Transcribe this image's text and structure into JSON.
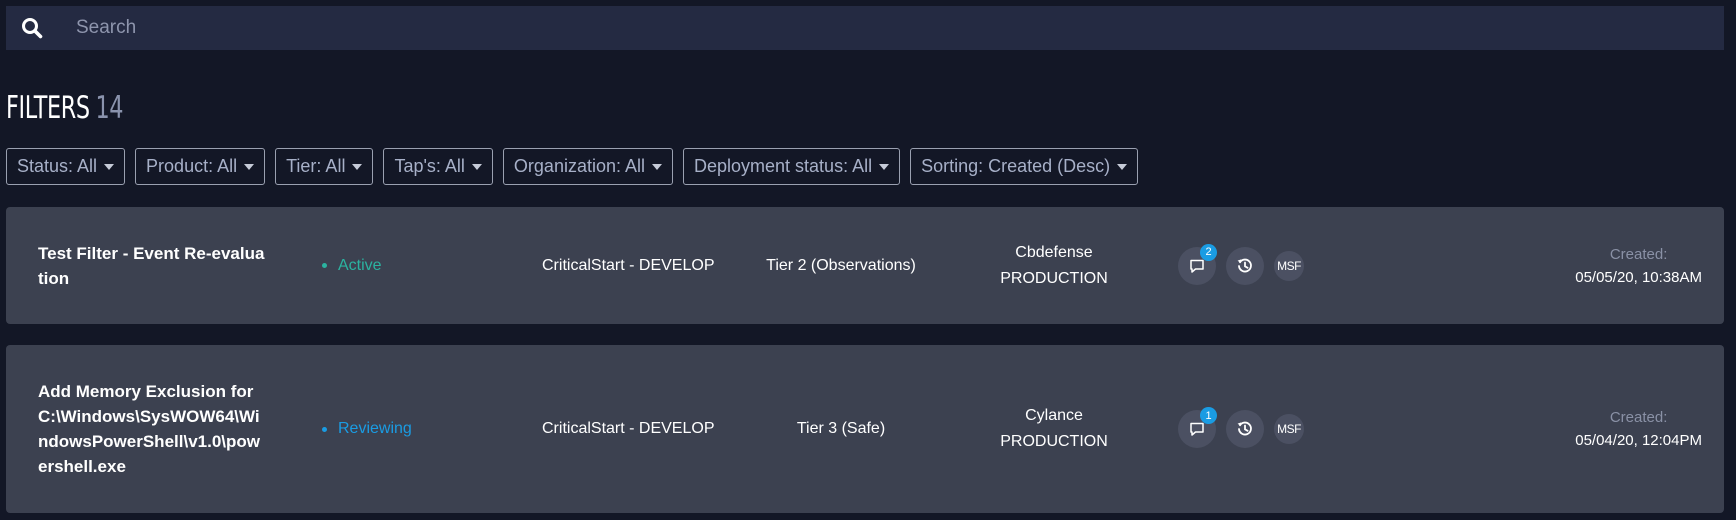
{
  "search": {
    "placeholder": "Search"
  },
  "header": {
    "title": "FILTERS",
    "count": "14"
  },
  "filterbar": [
    {
      "label": "Status: All"
    },
    {
      "label": "Product: All"
    },
    {
      "label": "Tier: All"
    },
    {
      "label": "Tap's: All"
    },
    {
      "label": "Organization: All"
    },
    {
      "label": "Deployment status: All"
    },
    {
      "label": "Sorting: Created (Desc)"
    }
  ],
  "colors": {
    "background": "#131726",
    "card": "#3c4150",
    "status_active": "#2bb3a0",
    "status_reviewing": "#1a9ce3",
    "badge": "#1a9ce3"
  },
  "filters": [
    {
      "name": "Test Filter - Event Re-evaluation",
      "status": "Active",
      "organization": "CriticalStart - DEVELOP",
      "tier": "Tier 2 (Observations)",
      "product": "Cbdefense",
      "deployment": "PRODUCTION",
      "comment_count": "2",
      "tag": "MSF",
      "created_label": "Created:",
      "created": "05/05/20, 10:38AM"
    },
    {
      "name": "Add Memory Exclusion for C:\\Windows\\SysWOW64\\WindowsPowerShell\\v1.0\\powershell.exe",
      "status": "Reviewing",
      "organization": "CriticalStart - DEVELOP",
      "tier": "Tier 3 (Safe)",
      "product": "Cylance",
      "deployment": "PRODUCTION",
      "comment_count": "1",
      "tag": "MSF",
      "created_label": "Created:",
      "created": "05/04/20, 12:04PM"
    }
  ],
  "icons": [
    "search-icon",
    "comment-icon",
    "history-icon",
    "caret-down-icon"
  ]
}
